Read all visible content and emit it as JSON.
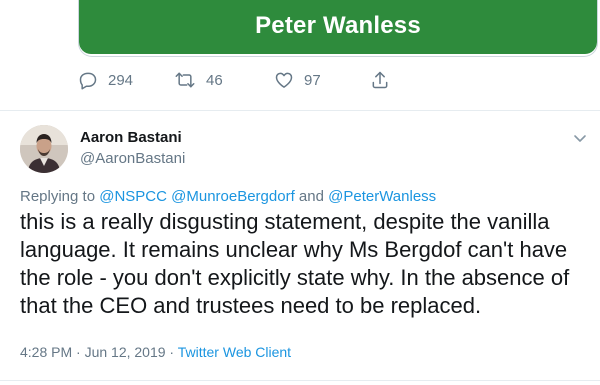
{
  "card": {
    "title": "Peter Wanless",
    "banner_color": "#2e8b3c"
  },
  "actions": {
    "reply_icon": "reply-icon",
    "reply_count": "294",
    "retweet_icon": "retweet-icon",
    "retweet_count": "46",
    "like_icon": "heart-icon",
    "like_count": "97",
    "share_icon": "share-icon"
  },
  "tweet": {
    "author_name": "Aaron Bastani",
    "author_handle": "@AaronBastani",
    "replying_prefix": "Replying to",
    "mention_1": "@NSPCC",
    "mention_2": "@MunroeBergdorf",
    "mention_and": "and",
    "mention_3": "@PeterWanless",
    "text": "this is a really disgusting statement, despite the vanilla language. It remains unclear why Ms Bergdof can't have the role - you don't explicitly state why. In the absence of that the CEO and trustees need to be replaced.",
    "timestamp": "4:28 PM · Jun 12, 2019 ·",
    "client": "Twitter Web Client"
  },
  "colors": {
    "link": "#1b95e0",
    "muted": "#657786",
    "text": "#14171a"
  }
}
